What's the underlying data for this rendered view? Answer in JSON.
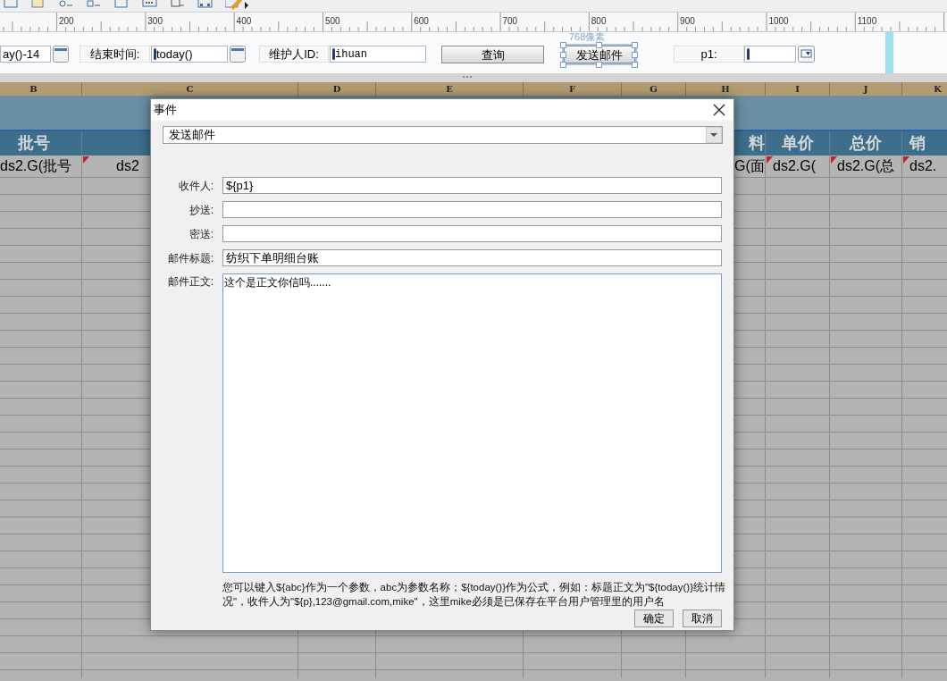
{
  "ruler": {
    "labels": [
      "200",
      "300",
      "400",
      "500",
      "600",
      "700",
      "800",
      "900",
      "1000",
      "1100"
    ]
  },
  "params": [
    {
      "kind": "input",
      "value": "ay()-14",
      "calendar": true,
      "cursor": false
    },
    {
      "kind": "label",
      "text": "结束时间:"
    },
    {
      "kind": "input",
      "value": "today()",
      "calendar": true,
      "cursor": true
    },
    {
      "kind": "label",
      "text": "维护人ID:"
    },
    {
      "kind": "input",
      "value": "ihuan",
      "calendar": false,
      "cursor": true
    },
    {
      "kind": "button",
      "text": "查询",
      "selected": false
    },
    {
      "kind": "button",
      "text": "发送邮件",
      "selected": true,
      "size_note": "768像素"
    },
    {
      "kind": "label",
      "text": "p1:"
    },
    {
      "kind": "input",
      "calendar": false,
      "cursor": true,
      "dropdown": true
    }
  ],
  "sheet": {
    "columns": [
      {
        "letter": "B",
        "header": "批号",
        "cell": "ds2.G(批号"
      },
      {
        "letter": "C",
        "cell": "ds2",
        "flag": true
      },
      {
        "letter": "D"
      },
      {
        "letter": "E"
      },
      {
        "letter": "F"
      },
      {
        "letter": "G"
      },
      {
        "letter": "H",
        "header": "料",
        "cell": "G(面"
      },
      {
        "letter": "I",
        "header": "单价",
        "cell": "ds2.G(",
        "flag": true
      },
      {
        "letter": "J",
        "header": "总价",
        "cell": "ds2.G(总",
        "flag": true
      },
      {
        "letter": "K",
        "header": "销",
        "cell": "ds2.",
        "flag": true
      }
    ]
  },
  "dialog": {
    "title": "事件",
    "event_type": "发送邮件",
    "fields": [
      {
        "label": "收件人:",
        "value": "${p1}"
      },
      {
        "label": "抄送:"
      },
      {
        "label": "密送:"
      },
      {
        "label": "邮件标题:",
        "value": "纺织下单明细台账"
      }
    ],
    "body": {
      "label": "邮件正文:",
      "value": "这个是正文你信吗......."
    },
    "hint": "您可以键入${abc}作为一个参数，abc为参数名称；${today()}作为公式，例如：标题正文为\"${today()}统计情况\"，收件人为\"${p},123@gmail.com,mike\"，这里mike必须是已保存在平台用户管理里的用户名",
    "buttons": [
      "确定",
      "取消"
    ]
  }
}
